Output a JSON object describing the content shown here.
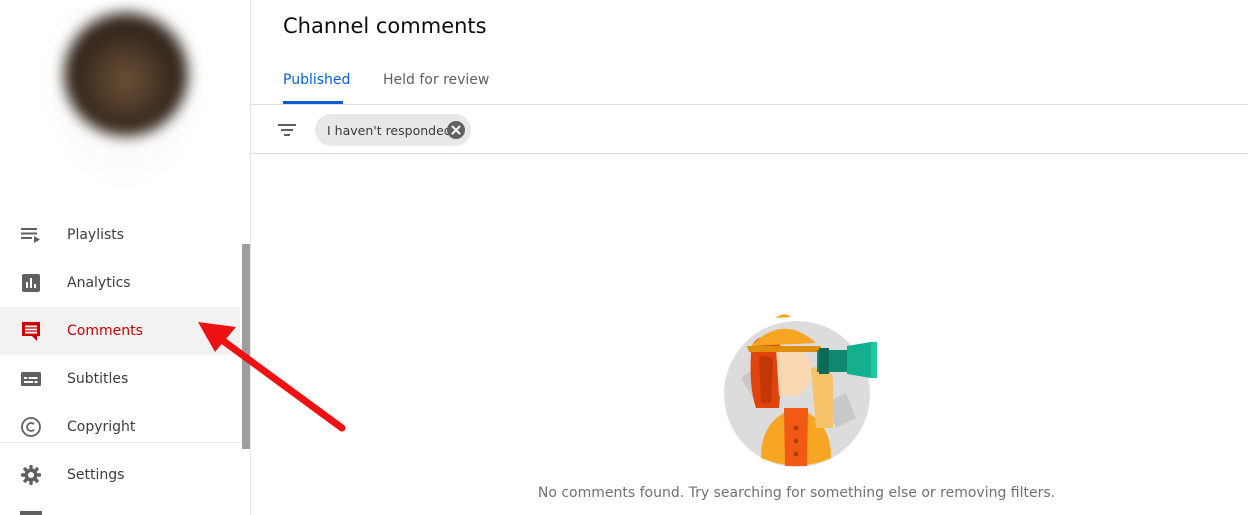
{
  "sidebar": {
    "items": [
      {
        "label": "Playlists",
        "icon": "playlist-icon"
      },
      {
        "label": "Analytics",
        "icon": "analytics-icon"
      },
      {
        "label": "Comments",
        "icon": "comments-icon",
        "active": true
      },
      {
        "label": "Subtitles",
        "icon": "subtitles-icon"
      },
      {
        "label": "Copyright",
        "icon": "copyright-icon"
      },
      {
        "label": "Settings",
        "icon": "settings-icon"
      }
    ]
  },
  "main": {
    "title": "Channel comments",
    "tabs": [
      {
        "label": "Published",
        "active": true
      },
      {
        "label": "Held for review"
      }
    ],
    "filter_chip": "I haven't responded",
    "empty_message": "No comments found. Try searching for something else or removing filters."
  },
  "colors": {
    "accent_blue": "#065fd4",
    "active_red": "#cc0000",
    "annotation_arrow": "#ee1111"
  }
}
